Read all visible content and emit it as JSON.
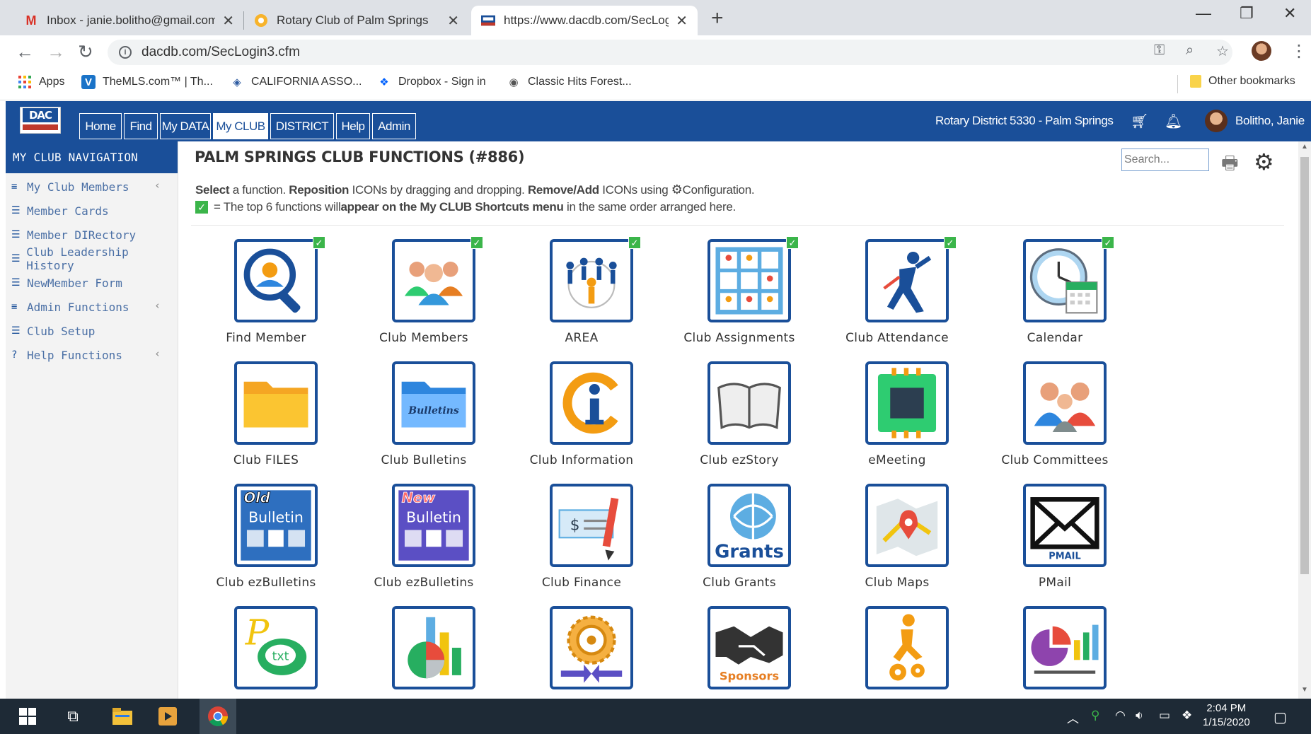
{
  "browser": {
    "tabs": [
      {
        "title": "Inbox - janie.bolitho@gmail.com",
        "favicon": "gmail-icon"
      },
      {
        "title": "Rotary Club of Palm Springs",
        "favicon": "rotary-icon"
      },
      {
        "title": "https://www.dacdb.com/SecLogin",
        "favicon": "dacdb-icon"
      }
    ],
    "url": "dacdb.com/SecLogin3.cfm",
    "bookmarks": [
      {
        "label": "Apps"
      },
      {
        "label": "TheMLS.com™ | Th..."
      },
      {
        "label": "CALIFORNIA ASSO..."
      },
      {
        "label": "Dropbox - Sign in"
      },
      {
        "label": "Classic Hits Forest..."
      }
    ],
    "other_bookmarks": "Other bookmarks"
  },
  "app": {
    "logo_text": "DAC db",
    "menu": [
      "Home",
      "Find",
      "My DATA",
      "My CLUB",
      "DISTRICT",
      "Help",
      "Admin"
    ],
    "active_menu": "My CLUB",
    "district": "Rotary District 5330 - Palm Springs",
    "user": "Bolitho, Janie",
    "accent": "#1a4f99",
    "check_color": "#3bb54a"
  },
  "sidebar": {
    "title": "MY CLUB NAVIGATION",
    "items": [
      {
        "label": "My Club Members",
        "icon": "menu-icon",
        "expandable": true
      },
      {
        "label": "Member Cards",
        "icon": "list-icon",
        "expandable": false
      },
      {
        "label": "Member DIRectory",
        "icon": "list-icon",
        "expandable": false
      },
      {
        "label": "Club Leadership History",
        "icon": "list-icon",
        "expandable": false
      },
      {
        "label": "NewMember Form",
        "icon": "list-icon",
        "expandable": false
      },
      {
        "label": "Admin Functions",
        "icon": "menu-icon",
        "expandable": true
      },
      {
        "label": "Club Setup",
        "icon": "list-icon",
        "expandable": false
      },
      {
        "label": "Help Functions",
        "icon": "question-icon",
        "expandable": true
      }
    ]
  },
  "main": {
    "title": "PALM SPRINGS CLUB FUNCTIONS (#886)",
    "search_placeholder": "Search...",
    "instructions": {
      "select": "Select",
      "t1": " a function. ",
      "reposition": "Reposition",
      "t2": " ICONs by dragging and dropping. ",
      "remove_add": "Remove/Add",
      "t3": " ICONs using ",
      "config": "Configuration.",
      "line2_a": "= The top 6 functions will ",
      "line2_b": "appear on the My CLUB Shortcuts menu",
      "line2_c": " in the same order arranged here."
    },
    "tiles": [
      {
        "label": "Find Member",
        "icon": "find-member-icon",
        "checked": true
      },
      {
        "label": "Club Members",
        "icon": "club-members-icon",
        "checked": true
      },
      {
        "label": "AREA",
        "icon": "area-icon",
        "checked": true
      },
      {
        "label": "Club Assignments",
        "icon": "club-assignments-icon",
        "checked": true
      },
      {
        "label": "Club Attendance",
        "icon": "club-attendance-icon",
        "checked": true
      },
      {
        "label": "Calendar",
        "icon": "calendar-icon",
        "checked": true
      },
      {
        "label": "Club FILES",
        "icon": "folder-icon",
        "checked": false
      },
      {
        "label": "Club Bulletins",
        "icon": "bulletins-folder-icon",
        "checked": false,
        "badge": "Bulletins"
      },
      {
        "label": "Club Information",
        "icon": "info-icon",
        "checked": false
      },
      {
        "label": "Club ezStory",
        "icon": "book-icon",
        "checked": false
      },
      {
        "label": "eMeeting",
        "icon": "chip-icon",
        "checked": false
      },
      {
        "label": "Club Committees",
        "icon": "committees-icon",
        "checked": false
      },
      {
        "label": "Club ezBulletins",
        "icon": "old-bulletin-icon",
        "checked": false,
        "badge": "Old",
        "sub": "Bulletin"
      },
      {
        "label": "Club ezBulletins",
        "icon": "new-bulletin-icon",
        "checked": false,
        "badge": "New",
        "sub": "Bulletin"
      },
      {
        "label": "Club Finance",
        "icon": "finance-icon",
        "checked": false
      },
      {
        "label": "Club Grants",
        "icon": "grants-icon",
        "checked": false,
        "badge": "Grants"
      },
      {
        "label": "Club Maps",
        "icon": "map-icon",
        "checked": false
      },
      {
        "label": "PMail",
        "icon": "mail-icon",
        "checked": false,
        "badge": "PMAIL"
      },
      {
        "label": "",
        "icon": "txt-icon",
        "checked": false,
        "badge": "txt"
      },
      {
        "label": "",
        "icon": "pie-chart-icon",
        "checked": false
      },
      {
        "label": "",
        "icon": "rotary-wheel-icon",
        "checked": false
      },
      {
        "label": "",
        "icon": "sponsors-icon",
        "checked": false,
        "badge": "Sponsors"
      },
      {
        "label": "",
        "icon": "walker-gear-icon",
        "checked": false
      },
      {
        "label": "",
        "icon": "reports-icon",
        "checked": false
      }
    ]
  },
  "taskbar": {
    "time": "2:04 PM",
    "date": "1/15/2020"
  }
}
